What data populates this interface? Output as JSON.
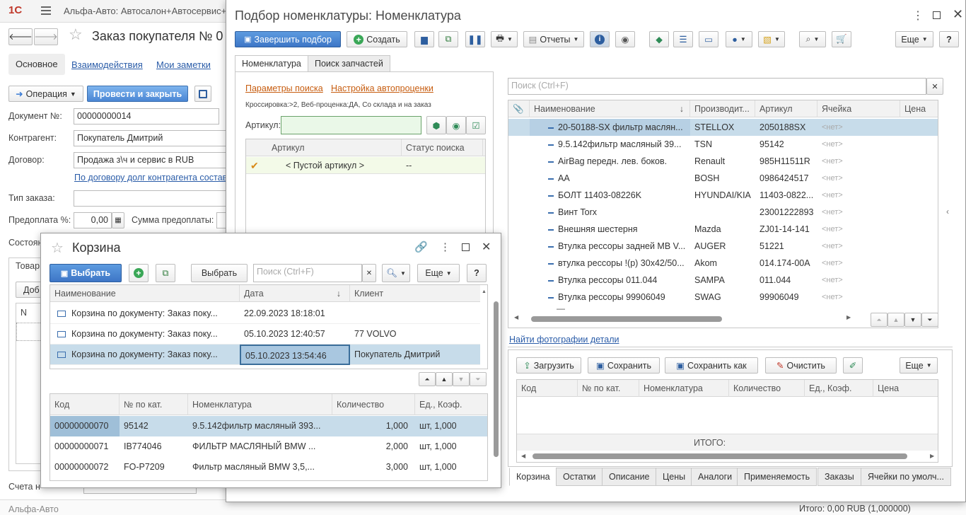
{
  "app": {
    "logo": "1С",
    "title": "Альфа-Авто: Автосалон+Автосервис+"
  },
  "order": {
    "title": "Заказ покупателя № 0",
    "tabs": [
      "Основное",
      "Взаимодействия",
      "Мои заметки"
    ],
    "operation": "Операция",
    "post_close": "Провести и закрыть",
    "doc_label": "Документ №:",
    "doc_value": "00000000014",
    "contractor_label": "Контрагент:",
    "contractor_value": "Покупатель Дмитрий",
    "contract_label": "Договор:",
    "contract_value": "Продажа з\\ч и сервис в RUB",
    "debt_link": "По договору долг контрагента составл",
    "order_type_label": "Тип заказа:",
    "prepay_label": "Предоплата %:",
    "prepay_value": "0,00",
    "prepay_sum_label": "Сумма предоплаты:",
    "state_label": "Состоян",
    "goods_tab": "Товар",
    "add_btn": "Доб",
    "n_col": "N",
    "invoice_label": "Счета н",
    "bottom_text": "Альфа-Авто",
    "total_text": "Итого: 0,00 RUB (1,000000)"
  },
  "picker": {
    "title": "Подбор номенклатуры: Номенклатура",
    "finish": "Завершить подбор",
    "create": "Создать",
    "reports": "Отчеты",
    "more": "Еще",
    "help": "?",
    "tabs": [
      "Номенклатура",
      "Поиск запчастей"
    ],
    "search_params": "Параметры поиска",
    "autoprice": "Настройка автопроценки",
    "cross_info": "Кроссировка:>2, Веб-проценка:ДА, Со склада и на заказ",
    "article_label": "Артикул:",
    "left_cols": [
      "Артикул",
      "Статус поиска"
    ],
    "left_row": {
      "article": "< Пустой артикул >",
      "status": "--"
    },
    "search_placeholder": "Поиск (Ctrl+F)",
    "cols": [
      "Наименование",
      "Производит...",
      "Артикул",
      "Ячейка",
      "Цена"
    ],
    "rows": [
      {
        "name": "20-50188-SX фильтр маслян...",
        "maker": "STELLOX",
        "art": "2050188SX",
        "cell": "<нет>"
      },
      {
        "name": "9.5.142фильтр масляный 39...",
        "maker": "TSN",
        "art": "95142",
        "cell": "<нет>"
      },
      {
        "name": "AirBag передн. лев. боков.",
        "maker": "Renault",
        "art": "985H11511R",
        "cell": "<нет>"
      },
      {
        "name": "AA",
        "maker": "BOSH",
        "art": "0986424517",
        "cell": "<нет>"
      },
      {
        "name": "БОЛТ 11403-08226K",
        "maker": "HYUNDAI/KIA",
        "art": "11403-0822...",
        "cell": "<нет>"
      },
      {
        "name": "Винт Torx",
        "maker": "",
        "art": "23001222893",
        "cell": "<нет>"
      },
      {
        "name": "Внешняя шестерня",
        "maker": "Mazda",
        "art": "ZJ01-14-141",
        "cell": "<нет>"
      },
      {
        "name": "Втулка рессоры задней MB V...",
        "maker": "AUGER",
        "art": "51221",
        "cell": "<нет>"
      },
      {
        "name": "втулка рессоры !(р) 30x42/50...",
        "maker": "Akom",
        "art": "014.174-00A",
        "cell": "<нет>"
      },
      {
        "name": "Втулка рессоры 011.044",
        "maker": "SAMPA",
        "art": "011.044",
        "cell": "<нет>"
      },
      {
        "name": "Втулка рессоры 99906049",
        "maker": "SWAG",
        "art": "99906049",
        "cell": "<нет>"
      }
    ],
    "photo_link": "Найти фотографии детали",
    "load": "Загрузить",
    "save": "Сохранить",
    "save_as": "Сохранить как",
    "clear": "Очистить",
    "bottom_cols": [
      "Код",
      "№ по кат.",
      "Номенклатура",
      "Количество",
      "Ед., Коэф.",
      "Цена"
    ],
    "itogo": "ИТОГО:",
    "bottom_tabs": [
      "Корзина",
      "Остатки",
      "Описание",
      "Цены",
      "Аналоги",
      "Применяемость",
      "Заказы",
      "Ячейки по умолч..."
    ]
  },
  "cart": {
    "title": "Корзина",
    "select_main": "Выбрать",
    "select": "Выбрать",
    "search_placeholder": "Поиск (Ctrl+F)",
    "more": "Еще",
    "help": "?",
    "cols": [
      "Наименование",
      "Дата",
      "Клиент"
    ],
    "rows": [
      {
        "name": "Корзина по документу: Заказ поку...",
        "date": "22.09.2023 18:18:01",
        "client": ""
      },
      {
        "name": "Корзина по документу: Заказ поку...",
        "date": "05.10.2023 12:40:57",
        "client": "77 VOLVO"
      },
      {
        "name": "Корзина по документу: Заказ поку...",
        "date": "05.10.2023 13:54:46",
        "client": "Покупатель Дмитрий"
      }
    ],
    "item_cols": [
      "Код",
      "№ по кат.",
      "Номенклатура",
      "Количество",
      "Ед., Коэф."
    ],
    "items": [
      {
        "code": "00000000070",
        "cat": "95142",
        "nom": "9.5.142фильтр масляный 393...",
        "qty": "1,000",
        "unit": "шт, 1,000"
      },
      {
        "code": "00000000071",
        "cat": "IB774046",
        "nom": "ФИЛЬТР МАСЛЯНЫЙ BMW ...",
        "qty": "2,000",
        "unit": "шт, 1,000"
      },
      {
        "code": "00000000072",
        "cat": "FO-P7209",
        "nom": "Фильтр масляный BMW 3,5,...",
        "qty": "3,000",
        "unit": "шт, 1,000"
      }
    ]
  }
}
